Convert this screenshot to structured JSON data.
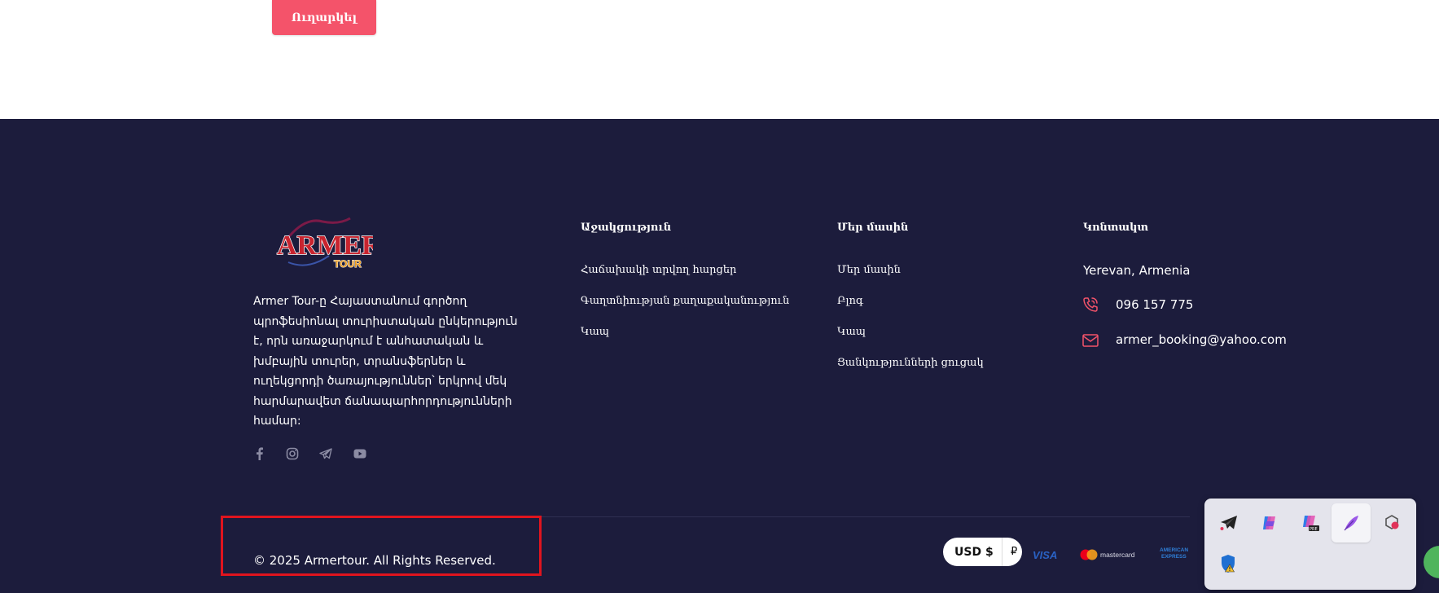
{
  "top": {
    "submit_label": "Ուղարկել"
  },
  "footer": {
    "brand": {
      "logo_name": "ARMER",
      "logo_sub": "TOUR"
    },
    "about_text": "Armer Tour-ը Հայաստանում գործող պրոֆեսիոնալ տուրիստական ընկերություն է, որն առաջարկում է անհատական և խմբային տուրեր, տրանսֆերներ և ուղեկցորդի ծառայություններ՝ երկրով մեկ հարմարավետ ճանապարհորդությունների համար:",
    "social_icons": [
      "facebook-icon",
      "instagram-icon",
      "telegram-icon",
      "youtube-icon"
    ],
    "support": {
      "title": "Աջակցություն",
      "links": [
        "Հաճախակի տրվող հարցեր",
        "Գաղտնիության քաղաքականություն",
        "Կապ"
      ]
    },
    "about_us": {
      "title": "Մեր մասին",
      "links": [
        "Մեր մասին",
        "Բլոգ",
        "Կապ",
        "Ցանկությունների ցուցակ"
      ]
    },
    "contacts": {
      "title": "Կոնտակտ",
      "address": "Yerevan, Armenia",
      "phone": "096 157 775",
      "email": "armer_booking@yahoo.com"
    },
    "copyright": "© 2025 Armertour. All Rights Reserved.",
    "currency": {
      "selected": "USD $",
      "alt": "₽"
    },
    "payments": {
      "visa": "VISA",
      "mastercard": "mastercard",
      "amex": "AMERICAN EXPRESS"
    }
  },
  "colors": {
    "footer_bg": "#1c1c3c",
    "accent": "#f4536a",
    "highlight": "#e0141e"
  },
  "tray_icons": [
    "telegram-icon",
    "copilot-icon",
    "copilot-preview-icon",
    "feather-icon",
    "app-icon",
    "security-warning-icon"
  ]
}
